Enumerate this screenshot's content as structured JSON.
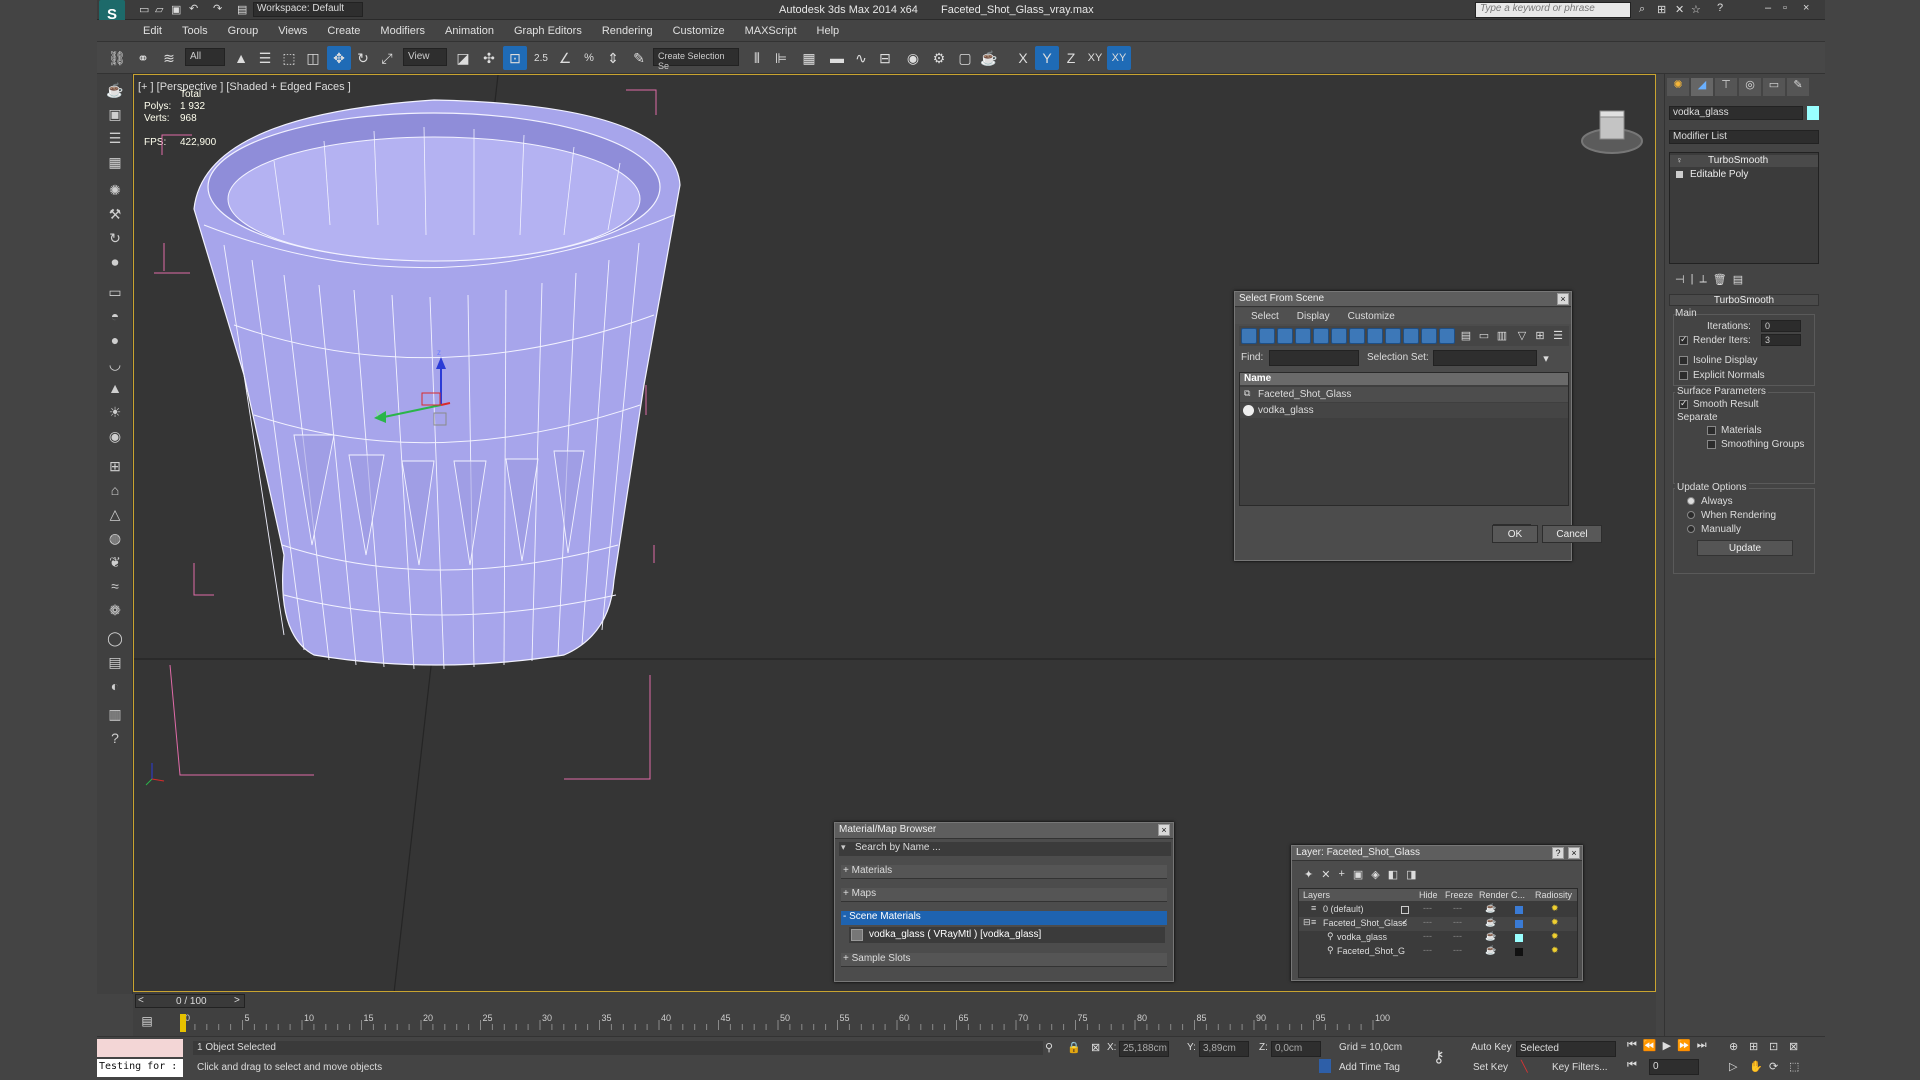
{
  "titlebar": {
    "app_title": "Autodesk 3ds Max  2014 x64",
    "file_name": "Faceted_Shot_Glass_vray.max",
    "workspace": "Workspace: Default",
    "search_placeholder": "Type a keyword or phrase"
  },
  "menu": [
    "Edit",
    "Tools",
    "Group",
    "Views",
    "Create",
    "Modifiers",
    "Animation",
    "Graph Editors",
    "Rendering",
    "Customize",
    "MAXScript",
    "Help"
  ],
  "toolbar": {
    "selection_filter": "All",
    "ref_coord": "View",
    "snap_angle": "2.5",
    "named_selection": "Create Selection Se",
    "axis_x": "X",
    "axis_y": "Y",
    "axis_z": "Z",
    "axis_xy": "XY",
    "axis_xy2": "XY"
  },
  "viewport": {
    "label": "[+ ] [Perspective ] [Shaded + Edged Faces ]",
    "stats_total": "Total",
    "polys_label": "Polys:",
    "polys_value": "1 932",
    "verts_label": "Verts:",
    "verts_value": "968",
    "fps_label": "FPS:",
    "fps_value": "422,900"
  },
  "command_panel": {
    "object_name": "vodka_glass",
    "modifier_list": "Modifier List",
    "stack": [
      "TurboSmooth",
      "Editable Poly"
    ],
    "rollout_title": "TurboSmooth",
    "main_label": "Main",
    "iterations_label": "Iterations:",
    "iterations_value": "0",
    "render_iters_label": "Render Iters:",
    "render_iters_value": "3",
    "isoline_label": "Isoline Display",
    "explicit_normals_label": "Explicit Normals",
    "surface_params_label": "Surface Parameters",
    "smooth_result_label": "Smooth Result",
    "separate_label": "Separate",
    "materials_label": "Materials",
    "smoothing_groups_label": "Smoothing Groups",
    "update_options_label": "Update Options",
    "always_label": "Always",
    "when_rendering_label": "When Rendering",
    "manually_label": "Manually",
    "update_button": "Update"
  },
  "select_from_scene": {
    "title": "Select From Scene",
    "menu": [
      "Select",
      "Display",
      "Customize"
    ],
    "find_label": "Find:",
    "selection_set_label": "Selection Set:",
    "column_name": "Name",
    "items": [
      "Faceted_Shot_Glass",
      "vodka_glass"
    ],
    "ok": "OK",
    "cancel": "Cancel"
  },
  "material_browser": {
    "title": "Material/Map Browser",
    "search_placeholder": "Search by Name ...",
    "groups": [
      "+ Materials",
      "+ Maps",
      "- Scene Materials",
      "+ Sample Slots"
    ],
    "scene_material": "vodka_glass ( VRayMtl ) [vodka_glass]"
  },
  "layer_dialog": {
    "title": "Layer: Faceted_Shot_Glass",
    "help": "?",
    "columns": [
      "Layers",
      "Hide",
      "Freeze",
      "Render",
      "C...",
      "Radiosity"
    ],
    "rows": [
      "0 (default)",
      "Faceted_Shot_Glass",
      "vodka_glass",
      "Faceted_Shot_G"
    ]
  },
  "timeline": {
    "frame_counter": "0 / 100",
    "ticks": [
      "0",
      "5",
      "10",
      "15",
      "20",
      "25",
      "30",
      "35",
      "40",
      "45",
      "50",
      "55",
      "60",
      "65",
      "70",
      "75",
      "80",
      "85",
      "90",
      "95",
      "100"
    ]
  },
  "status": {
    "maxscript_text": "Testing for :",
    "selected_text": "1 Object Selected",
    "prompt_text": "Click and drag to select and move objects",
    "x_label": "X:",
    "x_value": "25,188cm",
    "y_label": "Y:",
    "y_value": "3,89cm",
    "z_label": "Z:",
    "z_value": "0,0cm",
    "grid": "Grid = 10,0cm",
    "add_time_tag": "Add Time Tag",
    "auto_key": "Auto Key",
    "set_key": "Set Key",
    "key_mode": "Selected",
    "key_filters": "Key Filters...",
    "frame_value": "0"
  },
  "colors": {
    "glass_fill": "#a6a4ea",
    "accent_blue": "#1f6bb6",
    "viewport_border": "#c9a430"
  }
}
